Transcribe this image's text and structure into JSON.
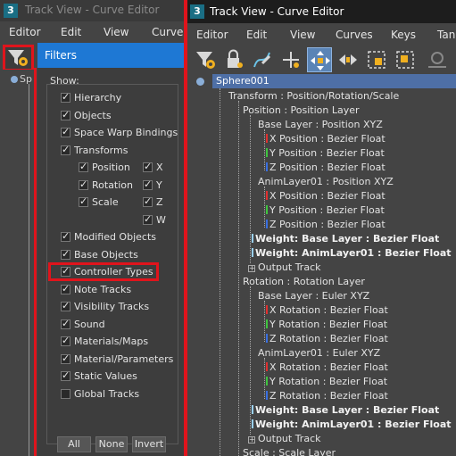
{
  "left_window": {
    "title": "Track View - Curve Editor",
    "menu": [
      "Editor",
      "Edit",
      "View",
      "Curves"
    ],
    "tree_stub": "Sp",
    "filters": {
      "header": "Filters",
      "show_label": "Show:",
      "items": [
        {
          "label": "Hierarchy",
          "checked": true
        },
        {
          "label": "Objects",
          "checked": true
        },
        {
          "label": "Space Warp Bindings",
          "checked": true
        },
        {
          "label": "Transforms",
          "checked": true
        },
        {
          "label": "Position",
          "checked": true
        },
        {
          "label": "Rotation",
          "checked": true
        },
        {
          "label": "Scale",
          "checked": true
        },
        {
          "label": "Modified Objects",
          "checked": true
        },
        {
          "label": "Base Objects",
          "checked": true
        },
        {
          "label": "Controller Types",
          "checked": true
        },
        {
          "label": "Note Tracks",
          "checked": true
        },
        {
          "label": "Visibility Tracks",
          "checked": true
        },
        {
          "label": "Sound",
          "checked": true
        },
        {
          "label": "Materials/Maps",
          "checked": true
        },
        {
          "label": "Material/Parameters",
          "checked": true
        },
        {
          "label": "Static Values",
          "checked": true
        },
        {
          "label": "Global Tracks",
          "checked": false
        }
      ],
      "axes": [
        "X",
        "Y",
        "Z",
        "W"
      ],
      "buttons": [
        "All",
        "None",
        "Invert"
      ]
    }
  },
  "right_window": {
    "title": "Track View - Curve Editor",
    "menu": [
      "Editor",
      "Edit",
      "View",
      "Curves",
      "Keys",
      "Tan"
    ],
    "tree": {
      "root": "Sphere001",
      "nodes": [
        "Transform : Position/Rotation/Scale",
        "Position : Position Layer",
        "Base Layer : Position XYZ",
        "X Position : Bezier Float",
        "Y Position : Bezier Float",
        "Z Position : Bezier Float",
        "AnimLayer01 : Position XYZ",
        "X Position : Bezier Float",
        "Y Position : Bezier Float",
        "Z Position : Bezier Float",
        "Weight: Base Layer : Bezier Float",
        "Weight: AnimLayer01 : Bezier Float",
        "Output Track",
        "Rotation : Rotation Layer",
        "Base Layer : Euler XYZ",
        "X Rotation : Bezier Float",
        "Y Rotation : Bezier Float",
        "Z Rotation : Bezier Float",
        "AnimLayer01 : Euler XYZ",
        "X Rotation : Bezier Float",
        "Y Rotation : Bezier Float",
        "Z Rotation : Bezier Float",
        "Weight: Base Layer : Bezier Float",
        "Weight: AnimLayer01 : Bezier Float",
        "Output Track",
        "Scale : Scale Layer"
      ]
    }
  },
  "colors": {
    "highlight_red": "#e0141c",
    "filters_header_blue": "#1e78d4",
    "axis_x": "#e03030",
    "axis_y": "#3fc43f",
    "axis_z": "#3a6fe0",
    "weight_bar": "#9ad0f0"
  }
}
